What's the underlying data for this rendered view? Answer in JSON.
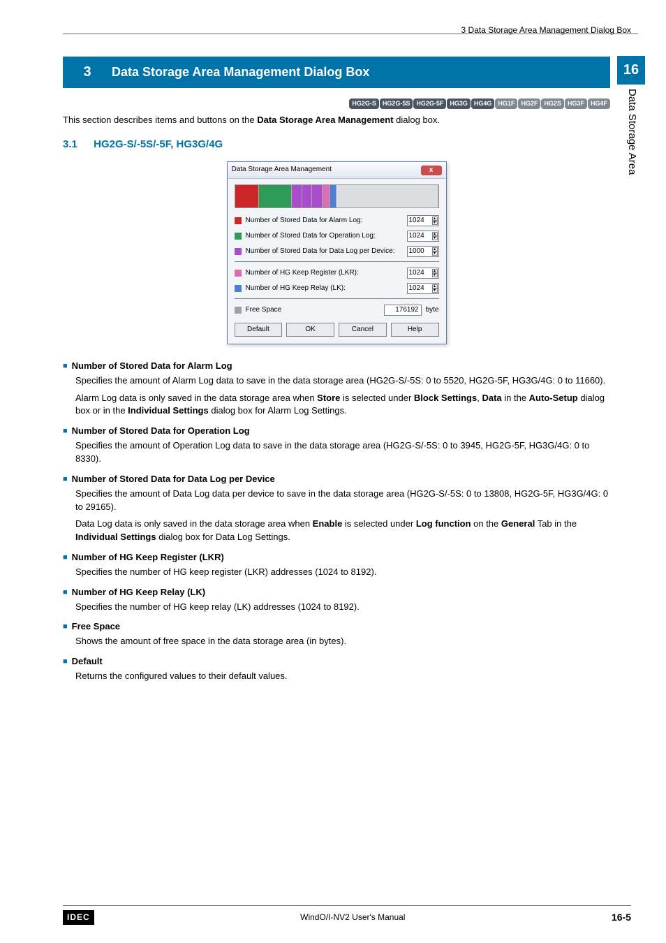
{
  "topRight": "3 Data Storage Area Management Dialog Box",
  "sideTab": {
    "num": "16",
    "text": "Data Storage Area"
  },
  "heading": {
    "num": "3",
    "title": "Data Storage Area Management Dialog Box"
  },
  "chips": [
    "HG2G-S",
    "HG2G-5S",
    "HG2G-5F",
    "HG3G",
    "HG4G",
    "HG1F",
    "HG2F",
    "HG2S",
    "HG3F",
    "HG4F"
  ],
  "intro_a": "This section describes items and buttons on the ",
  "intro_b": "Data Storage Area Management",
  "intro_c": " dialog box.",
  "subhead": {
    "num": "3.1",
    "title": "HG2G-S/-5S/-5F, HG3G/4G"
  },
  "dialog": {
    "title": "Data Storage Area Management",
    "rows": [
      {
        "sw": "red",
        "label": "Number of Stored Data for Alarm Log:",
        "value": "1024"
      },
      {
        "sw": "green",
        "label": "Number of Stored Data for Operation Log:",
        "value": "1024"
      },
      {
        "sw": "purple",
        "label": "Number of Stored Data for Data Log per Device:",
        "value": "1000"
      }
    ],
    "rows2": [
      {
        "sw": "pink",
        "label": "Number of HG Keep Register (LKR):",
        "value": "1024"
      },
      {
        "sw": "blue",
        "label": "Number of HG Keep Relay (LK):",
        "value": "1024"
      }
    ],
    "free": {
      "sw": "grey",
      "label": "Free Space",
      "value": "176192",
      "unit": "byte"
    },
    "buttons": {
      "default": "Default",
      "ok": "OK",
      "cancel": "Cancel",
      "help": "Help"
    }
  },
  "items": [
    {
      "head": "Number of Stored Data for Alarm Log",
      "paras": [
        "Specifies the amount of Alarm Log data to save in the data storage area (HG2G-S/-5S: 0 to 5520, HG2G-5F, HG3G/4G: 0 to 11660).",
        "Alarm Log data is only saved in the data storage area when <b>Store</b> is selected under <b>Block Settings</b>, <b>Data</b> in the <b>Auto-Setup</b> dialog box or in the <b>Individual Settings</b> dialog box for Alarm Log Settings."
      ]
    },
    {
      "head": "Number of Stored Data for Operation Log",
      "paras": [
        "Specifies the amount of Operation Log data to save in the data storage area (HG2G-S/-5S: 0 to 3945, HG2G-5F, HG3G/4G: 0 to 8330)."
      ]
    },
    {
      "head": "Number of Stored Data for Data Log per Device",
      "paras": [
        "Specifies the amount of Data Log data per device to save in the data storage area (HG2G-S/-5S: 0 to 13808, HG2G-5F, HG3G/4G: 0 to 29165).",
        "Data Log data is only saved in the data storage area when <b>Enable</b> is selected under <b>Log function</b> on the <b>General</b> Tab in the <b>Individual Settings</b> dialog box for Data Log Settings."
      ]
    },
    {
      "head": "Number of HG Keep Register (LKR)",
      "paras": [
        "Specifies the number of HG keep register (LKR) addresses (1024 to 8192)."
      ]
    },
    {
      "head": "Number of HG Keep Relay (LK)",
      "paras": [
        "Specifies the number of HG keep relay (LK) addresses (1024 to 8192)."
      ]
    },
    {
      "head": "Free Space",
      "paras": [
        "Shows the amount of free space in the data storage area (in bytes)."
      ]
    },
    {
      "head": "Default",
      "paras": [
        "Returns the configured values to their default values."
      ]
    }
  ],
  "footer": {
    "brand": "IDEC",
    "center": "WindO/I-NV2 User's Manual",
    "page": "16-5"
  }
}
